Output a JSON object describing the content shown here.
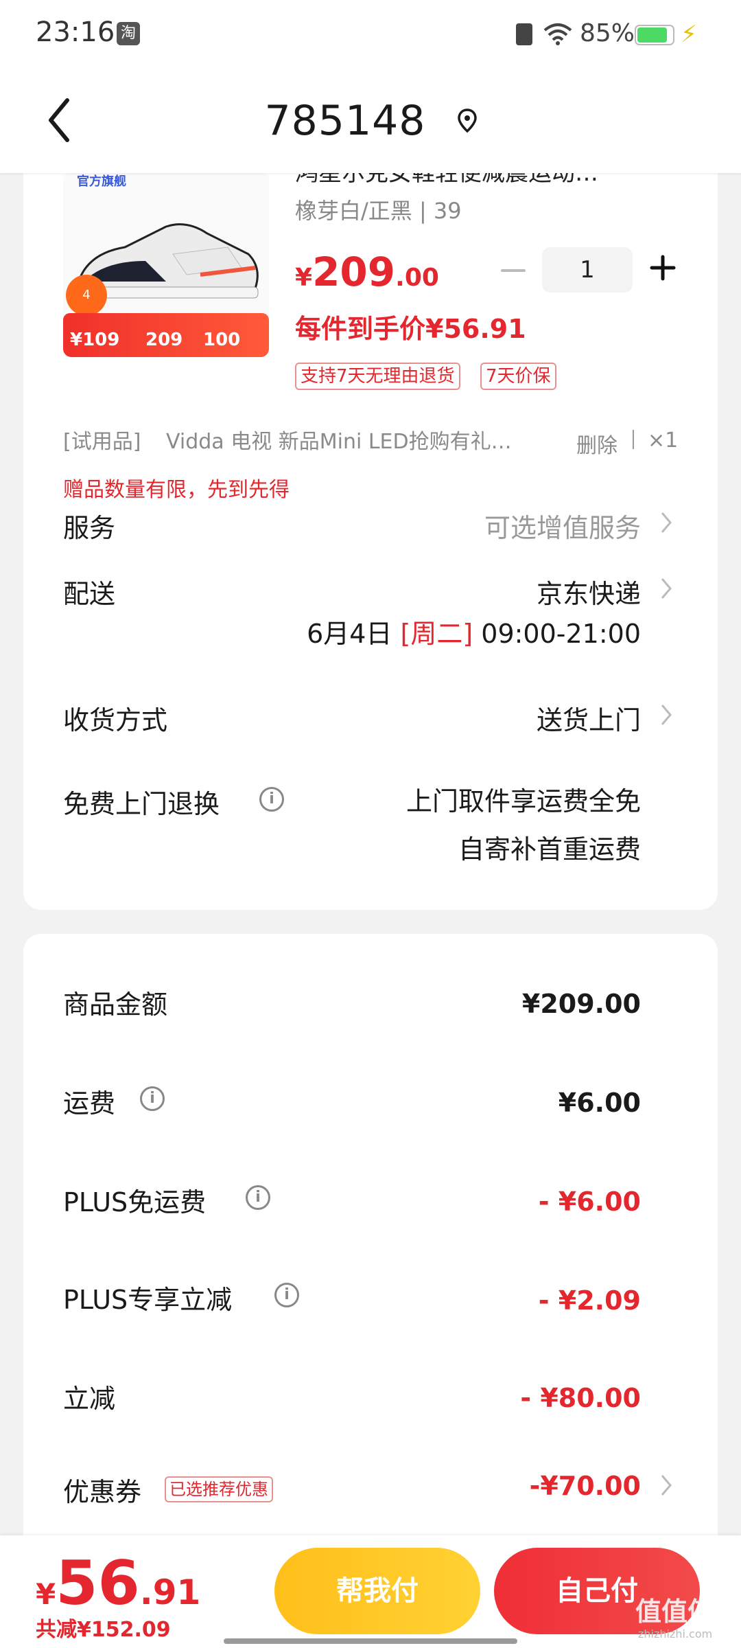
{
  "status_bar": {
    "time": "23:16",
    "app_icon": "taobao-icon",
    "battery_percent": "85%",
    "icons": [
      "sim-icon",
      "wifi-icon",
      "battery-icon",
      "charge-icon"
    ]
  },
  "nav": {
    "title": "785148",
    "back_icon": "back-icon",
    "location_icon": "location-pin-icon"
  },
  "product": {
    "title_partial": "鸿星尔克女鞋轻便减震运动…",
    "spec": "橡芽白/正黑 | 39",
    "price_currency": "¥",
    "price_int": "209",
    "price_dec": ".00",
    "quantity": "1",
    "net_price": "每件到手价¥56.91",
    "tags": [
      "支持7天无理由退货",
      "7天价保"
    ],
    "image_brand": "官方旗舰",
    "image_badge": "4",
    "image_promo_price": "¥109",
    "image_promo_mid": "209",
    "image_promo_right": "100"
  },
  "gift": {
    "label": "[试用品]",
    "name": "Vidda 电视 新品Mini LED抢购有礼…",
    "delete_label": "删除",
    "qty": "×1",
    "notice": "赠品数量有限，先到先得"
  },
  "rows": {
    "service_label": "服务",
    "service_value": "可选增值服务",
    "delivery_label": "配送",
    "delivery_value": "京东快递",
    "delivery_date": "6月4日",
    "delivery_day": "[周二]",
    "delivery_window": "09:00-21:00",
    "receive_label": "收货方式",
    "receive_value": "送货上门",
    "return_label": "免费上门退换",
    "return_value_line1": "上门取件享运费全免",
    "return_value_line2": "自寄补首重运费"
  },
  "summary": {
    "goods_label": "商品金额",
    "goods_value": "¥209.00",
    "shipping_label": "运费",
    "shipping_value": "¥6.00",
    "plus_free_label": "PLUS免运费",
    "plus_free_value": "- ¥6.00",
    "plus_discount_label": "PLUS专享立减",
    "plus_discount_value": "- ¥2.09",
    "instant_label": "立减",
    "instant_value": "- ¥80.00",
    "coupon_label": "优惠券",
    "coupon_tag": "已选推荐优惠",
    "coupon_value": "-¥70.00"
  },
  "bottom": {
    "currency": "¥",
    "total_int": "56",
    "total_dec": ".91",
    "discount_total": "共减¥152.09",
    "help_pay": "帮我付",
    "self_pay": "自己付",
    "watermark": "值值值",
    "watermark_url": "zhizhizhi.com"
  },
  "colors": {
    "accent_red": "#e4272e",
    "help_pay_yellow": "#ffc21f",
    "self_pay_red": "#ef2f36",
    "background": "#f2f2f2"
  }
}
